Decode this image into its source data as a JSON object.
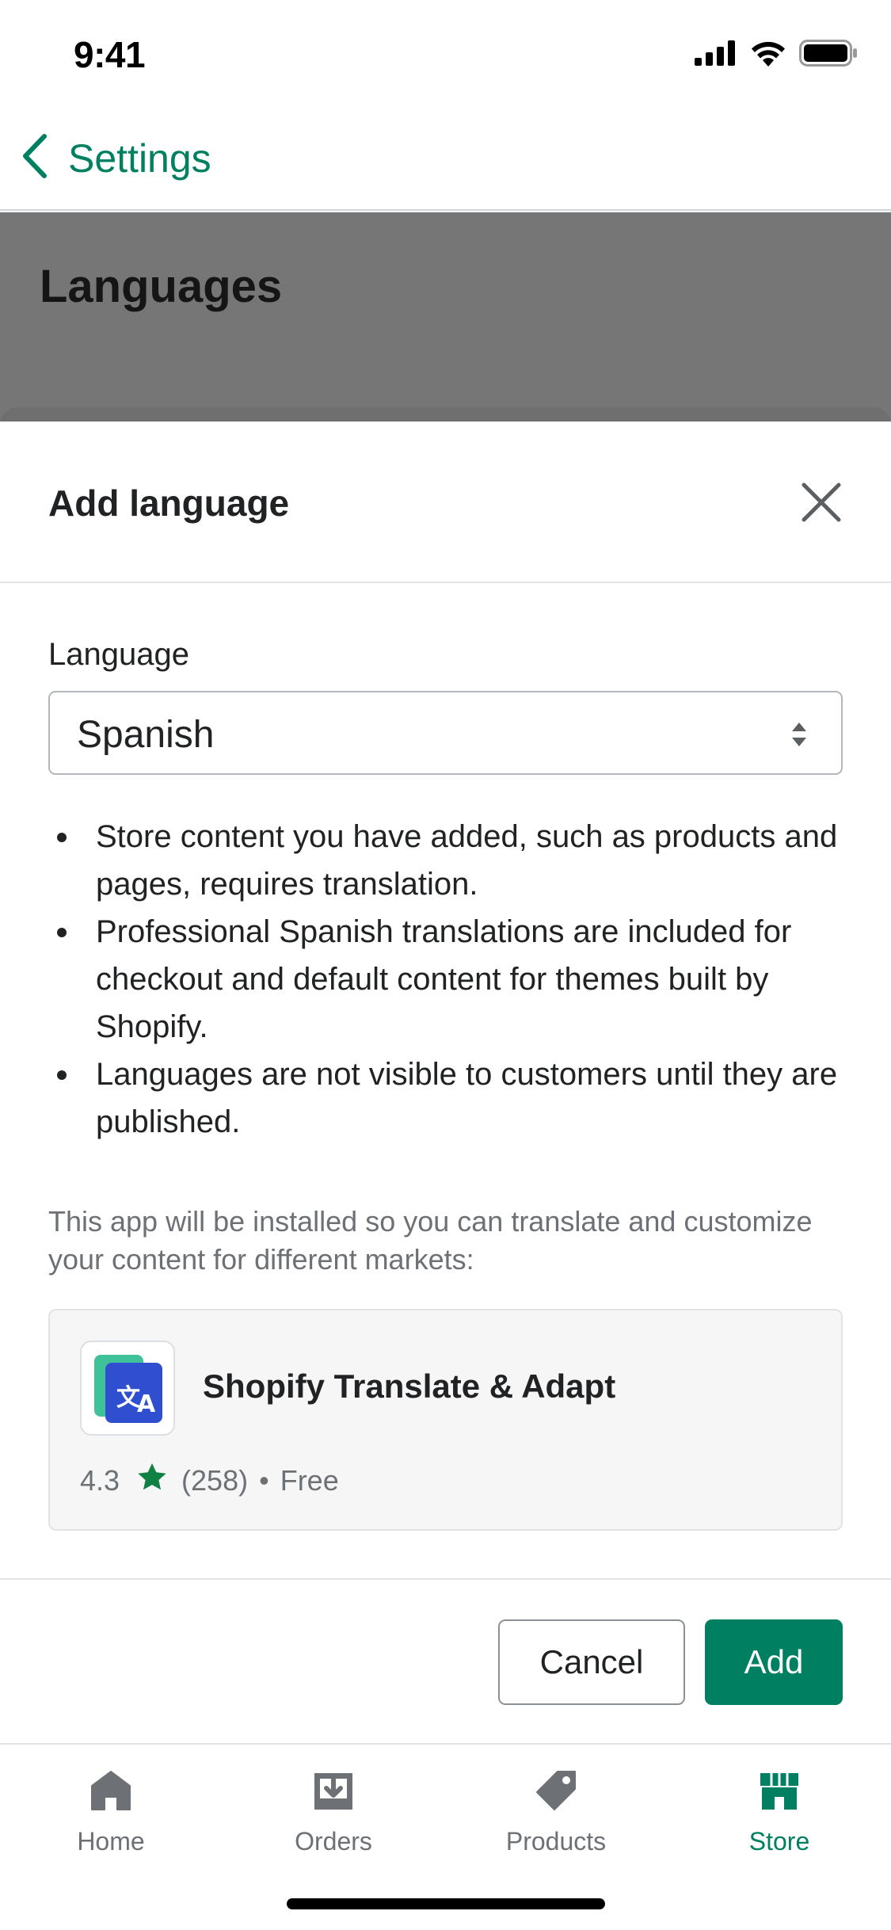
{
  "status_bar": {
    "time": "9:41"
  },
  "nav": {
    "back_label": "Settings"
  },
  "page": {
    "title": "Languages"
  },
  "sheet": {
    "title": "Add language",
    "language_label": "Language",
    "language_value": "Spanish",
    "bullets": [
      "Store content you have added, such as products and pages, requires translation.",
      "Professional Spanish translations are included for checkout and default content for themes built by Shopify.",
      "Languages are not visible to customers until they are published."
    ],
    "app_note": "This app will be installed so you can translate and customize your content for different markets:",
    "app": {
      "name": "Shopify Translate & Adapt",
      "rating": "4.3",
      "reviews": "(258)",
      "separator": "•",
      "price": "Free"
    },
    "cancel_label": "Cancel",
    "add_label": "Add"
  },
  "tabs": [
    {
      "label": "Home",
      "icon": "home-icon",
      "active": false
    },
    {
      "label": "Orders",
      "icon": "orders-icon",
      "active": false
    },
    {
      "label": "Products",
      "icon": "tag-icon",
      "active": false
    },
    {
      "label": "Store",
      "icon": "store-icon",
      "active": true
    }
  ],
  "colors": {
    "accent": "#008060",
    "overlay": "#767676",
    "muted_text": "#6d7175",
    "star": "#108043",
    "app_icon_blue": "#2f4fd0",
    "app_icon_green": "#3fc29a"
  }
}
